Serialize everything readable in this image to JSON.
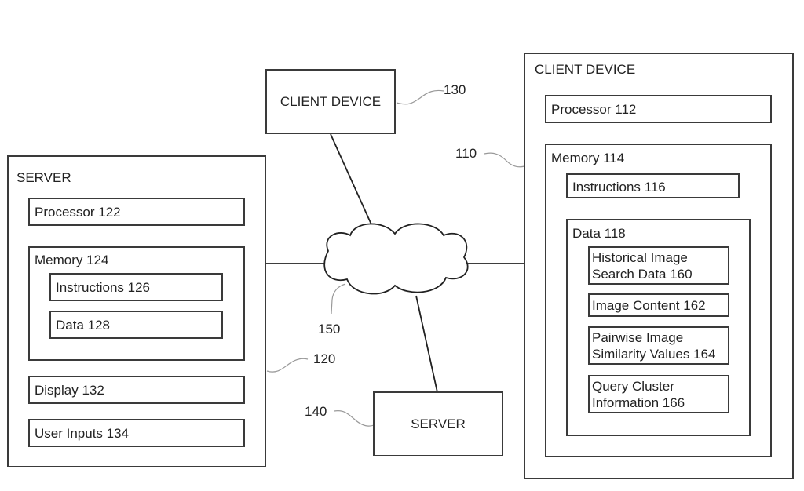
{
  "diagram": {
    "server_120": {
      "title": "SERVER",
      "ref": "120",
      "processor": "Processor 122",
      "memory": {
        "label": "Memory 124",
        "instructions": "Instructions 126",
        "data": "Data 128"
      },
      "display": "Display 132",
      "user_inputs": "User Inputs 134"
    },
    "client_device_130": {
      "title": "CLIENT DEVICE",
      "ref": "130"
    },
    "server_140": {
      "title": "SERVER",
      "ref": "140"
    },
    "network_150": {
      "ref": "150"
    },
    "client_device_110": {
      "title": "CLIENT DEVICE",
      "ref": "110",
      "processor": "Processor 112",
      "memory": {
        "label": "Memory 114",
        "instructions": "Instructions 116",
        "data": {
          "label": "Data 118",
          "items": [
            {
              "line1": "Historical Image",
              "line2": "Search Data 160"
            },
            {
              "line1": "Image Content 162",
              "line2": ""
            },
            {
              "line1": "Pairwise Image",
              "line2": "Similarity Values 164"
            },
            {
              "line1": "Query Cluster",
              "line2": "Information 166"
            }
          ]
        }
      }
    }
  }
}
